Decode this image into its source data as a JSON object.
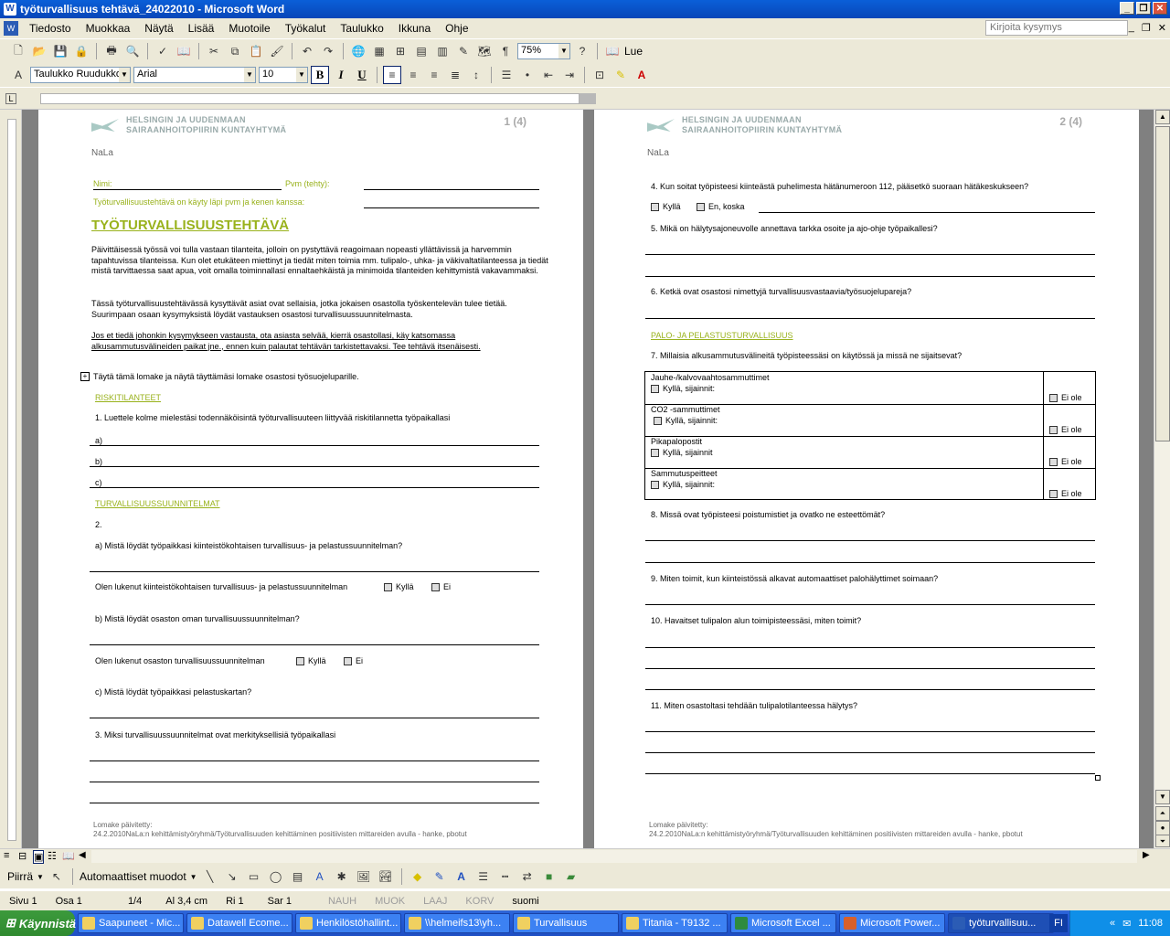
{
  "window": {
    "title": "työturvallisuus tehtävä_24022010 - Microsoft Word",
    "app_icon": "W"
  },
  "menu": {
    "items": [
      "Tiedosto",
      "Muokkaa",
      "Näytä",
      "Lisää",
      "Muotoile",
      "Työkalut",
      "Taulukko",
      "Ikkuna",
      "Ohje"
    ],
    "help_placeholder": "Kirjoita kysymys"
  },
  "toolbar": {
    "zoom": "75%",
    "read": "Lue",
    "style": "Taulukko Ruudukko",
    "font": "Arial",
    "size": "10"
  },
  "page1": {
    "logo_line1": "HELSINGIN JA UUDENMAAN",
    "logo_line2": "SAIRAANHOITOPIIRIN KUNTAYHTYMÄ",
    "page_num": "1 (4)",
    "nala": "NaLa",
    "name_label": "Nimi:",
    "date_label": "Pvm (tehty):",
    "with_label": "Työturvallisuustehtävä on käyty läpi pvm ja kenen kanssa:",
    "heading": "TYÖTURVALLISUUSTEHTÄVÄ",
    "intro1": "Päivittäisessä työssä voi tulla vastaan tilanteita, jolloin on pystyttävä reagoimaan nopeasti yllättävissä ja harvemmin tapahtuvissa tilanteissa. Kun olet etukäteen miettinyt ja tiedät miten toimia mm. tulipalo-, uhka- ja väkivaltatilanteessa ja tiedät mistä tarvittaessa saat apua, voit omalla toiminnallasi ennaltaehkäistä ja minimoida tilanteiden kehittymistä vakavammaksi.",
    "intro2": "Tässä työturvallisuustehtävässä kysyttävät asiat ovat sellaisia, jotka jokaisen osastolla työskentelevän tulee tietää. Suurimpaan osaan kysymyksistä löydät vastauksen osastosi turvallisuussuunnitelmasta.",
    "intro3": "Jos et tiedä johonkin kysymykseen vastausta, ota asiasta selvää, kierrä osastollasi, käy katsomassa alkusammutusvälineiden paikat jne., ennen kuin palautat tehtävän tarkistettavaksi. Tee tehtävä itsenäisesti.",
    "fill": "Täytä tämä lomake ja näytä täyttämäsi lomake osastosi työsuojeluparille.",
    "sec1": "RISKITILANTEET",
    "q1": "1.    Luettele kolme mielestäsi todennäköisintä työturvallisuuteen liittyvää riskitilannetta työpaikallasi",
    "a": "a)",
    "b": "b)",
    "c": "c)",
    "sec2": "TURVALLISUUSSUUNNITELMAT",
    "q2": "2.",
    "q2a": "a) Mistä löydät työpaikkasi kiinteistökohtaisen turvallisuus- ja pelastussuunnitelman?",
    "q2a_read": "Olen lukenut kiinteistökohtaisen turvallisuus- ja pelastussuunnitelman",
    "q2b": "b) Mistä löydät osaston oman turvallisuussuunnitelman?",
    "q2b_read": "Olen lukenut osaston turvallisuussuunnitelman",
    "q2c": "c) Mistä löydät työpaikkasi pelastuskartan?",
    "q3": "3.    Miksi turvallisuussuunnitelmat ovat merkityksellisiä työpaikallasi",
    "yes": "Kyllä",
    "no": "Ei",
    "footer1": "Lomake päivitetty:",
    "footer2": "24.2.2010NaLa:n kehittämistyöryhmä/Työturvallisuuden kehittäminen positiivisten mittareiden avulla - hanke, pbotut"
  },
  "page2": {
    "logo_line1": "HELSINGIN JA UUDENMAAN",
    "logo_line2": "SAIRAANHOITOPIIRIN KUNTAYHTYMÄ",
    "page_num": "2 (4)",
    "nala": "NaLa",
    "q4": "4.    Kun soitat työpisteesi kiinteästä puhelimesta hätänumeroon 112, pääsetkö suoraan hätäkeskukseen?",
    "q4_yes": "Kyllä",
    "q4_no": "En, koska",
    "q5": "5.    Mikä on hälytysajoneuvolle annettava tarkka osoite ja ajo-ohje työpaikallesi?",
    "q6": "6.    Ketkä ovat osastosi nimettyjä turvallisuusvastaavia/työsuojelupareja?",
    "sec": "PALO- JA PELASTUSTURVALLISUUS",
    "q7": "7.    Millaisia alkusammutusvälineitä työpisteessäsi on käytössä ja missä ne sijaitsevat?",
    "rows": [
      {
        "name": "Jauhe-/kalvovaahtosammuttimet",
        "loc": "Kyllä, sijainnit:",
        "none": "Ei ole"
      },
      {
        "name": "CO2 -sammuttimet",
        "loc": "Kyllä, sijainnit:",
        "none": "Ei ole"
      },
      {
        "name": "Pikapalopostit",
        "loc": "Kyllä, sijainnit",
        "none": "Ei ole"
      },
      {
        "name": "Sammutuspeitteet",
        "loc": "Kyllä, sijainnit:",
        "none": "Ei ole"
      }
    ],
    "q8": "8.    Missä ovat työpisteesi poistumistiet ja ovatko ne esteettömät?",
    "q9": "9.    Miten toimit, kun kiinteistössä alkavat automaattiset palohälyttimet soimaan?",
    "q10": "10. Havaitset tulipalon alun toimipisteessäsi, miten toimit?",
    "q11": "11. Miten osastoltasi tehdään tulipalotilanteessa hälytys?",
    "footer1": "Lomake päivitetty:",
    "footer2": "24.2.2010NaLa:n kehittämistyöryhmä/Työturvallisuuden kehittäminen positiivisten mittareiden avulla - hanke, pbotut"
  },
  "drawbar": {
    "draw": "Piirrä",
    "autoshapes": "Automaattiset muodot"
  },
  "status": {
    "page": "Sivu 1",
    "section": "Osa 1",
    "pages": "1/4",
    "at": "Al 3,4 cm",
    "line": "Ri 1",
    "col": "Sar 1",
    "rec": "NAUH",
    "trk": "MUOK",
    "ext": "LAAJ",
    "ovr": "KORV",
    "lang": "suomi"
  },
  "taskbar": {
    "start": "Käynnistä",
    "tasks": [
      "Saapuneet - Mic...",
      "Datawell Ecome...",
      "Henkilöstöhallint...",
      "\\\\helmeifs13\\yh...",
      "Turvallisuus",
      "Titania - T9132 ...",
      "Microsoft Excel ...",
      "Microsoft Power...",
      "työturvallisuu..."
    ],
    "lang": "FI",
    "clock": "11:08"
  }
}
